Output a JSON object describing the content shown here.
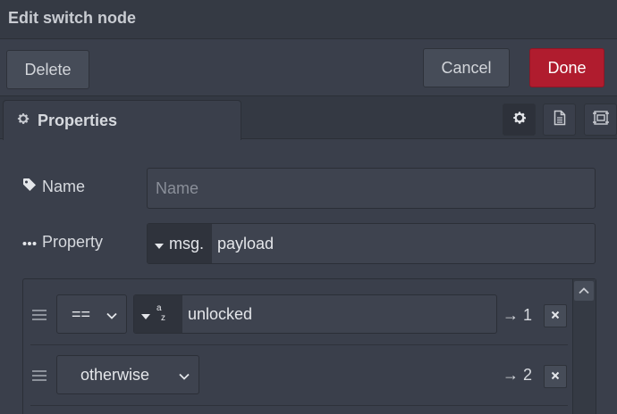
{
  "dialog": {
    "title": "Edit switch node"
  },
  "actions": {
    "delete_label": "Delete",
    "cancel_label": "Cancel",
    "done_label": "Done"
  },
  "tabs": [
    {
      "label": "Properties",
      "icon": "gear-icon"
    }
  ],
  "tab_icons": [
    "gear-icon",
    "document-icon",
    "frame-icon"
  ],
  "name": {
    "label": "Name",
    "placeholder": "Name",
    "value": ""
  },
  "property": {
    "label": "Property",
    "type": "msg.",
    "value": "payload"
  },
  "rules": [
    {
      "operator": "==",
      "value_type_icon": "string-az-icon",
      "value": "unlocked",
      "output": "→ 1"
    },
    {
      "operator": "otherwise",
      "output": "→ 2"
    }
  ],
  "colors": {
    "accent_done": "#b01c2e",
    "background": "#3a3f4b"
  }
}
